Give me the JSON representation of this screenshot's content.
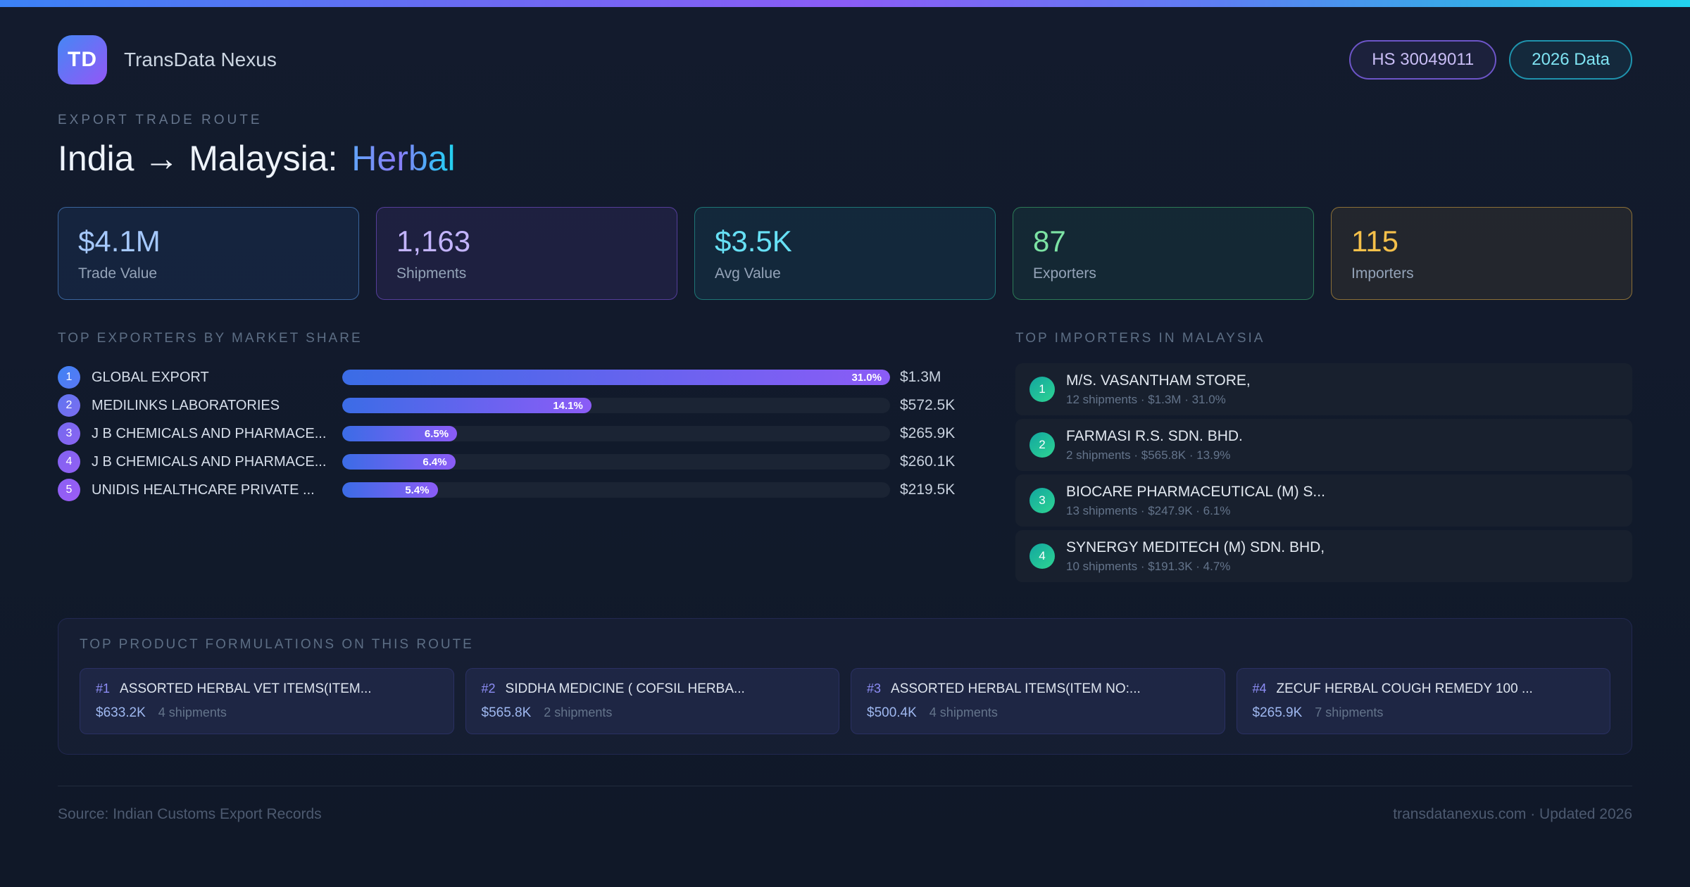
{
  "colors": {
    "accent_blue": "#3b82f6",
    "accent_purple": "#8b5cf6",
    "accent_cyan": "#22d3ee",
    "accent_teal": "#2ed492",
    "accent_amber": "#f5c04a",
    "background": "#111a2b"
  },
  "header": {
    "logo_text": "TD",
    "brand": "TransData Nexus",
    "badges": [
      {
        "label": "HS 30049011"
      },
      {
        "label": "2026 Data"
      }
    ]
  },
  "hero": {
    "eyebrow": "EXPORT TRADE ROUTE",
    "title_main": "India → Malaysia:",
    "title_accent": "Herbal"
  },
  "stats": [
    {
      "value": "$4.1M",
      "label": "Trade Value"
    },
    {
      "value": "1,163",
      "label": "Shipments"
    },
    {
      "value": "$3.5K",
      "label": "Avg Value"
    },
    {
      "value": "87",
      "label": "Exporters"
    },
    {
      "value": "115",
      "label": "Importers"
    }
  ],
  "exporters": {
    "title": "TOP EXPORTERS BY MARKET SHARE",
    "rows": [
      {
        "rank": "1",
        "name": "GLOBAL EXPORT",
        "share_pct": 31.0,
        "share_label": "31.0%",
        "value": "$1.3M"
      },
      {
        "rank": "2",
        "name": "MEDILINKS LABORATORIES",
        "share_pct": 14.1,
        "share_label": "14.1%",
        "value": "$572.5K"
      },
      {
        "rank": "3",
        "name": "J B CHEMICALS AND PHARMACE...",
        "share_pct": 6.5,
        "share_label": "6.5%",
        "value": "$265.9K"
      },
      {
        "rank": "4",
        "name": "J B CHEMICALS AND PHARMACE...",
        "share_pct": 6.4,
        "share_label": "6.4%",
        "value": "$260.1K"
      },
      {
        "rank": "5",
        "name": "UNIDIS HEALTHCARE PRIVATE ...",
        "share_pct": 5.4,
        "share_label": "5.4%",
        "value": "$219.5K"
      }
    ]
  },
  "importers": {
    "title": "TOP IMPORTERS IN MALAYSIA",
    "rows": [
      {
        "rank": "1",
        "name": "M/S. VASANTHAM STORE,",
        "meta": "12 shipments · $1.3M · 31.0%"
      },
      {
        "rank": "2",
        "name": "FARMASI R.S. SDN. BHD.",
        "meta": "2 shipments · $565.8K · 13.9%"
      },
      {
        "rank": "3",
        "name": "BIOCARE PHARMACEUTICAL (M) S...",
        "meta": "13 shipments · $247.9K · 6.1%"
      },
      {
        "rank": "4",
        "name": "SYNERGY MEDITECH (M) SDN. BHD,",
        "meta": "10 shipments · $191.3K · 4.7%"
      }
    ]
  },
  "products": {
    "title": "TOP PRODUCT FORMULATIONS ON THIS ROUTE",
    "cards": [
      {
        "rank": "#1",
        "name": "ASSORTED HERBAL VET ITEMS(ITEM...",
        "value": "$633.2K",
        "shipments": "4 shipments"
      },
      {
        "rank": "#2",
        "name": "SIDDHA MEDICINE ( COFSIL HERBA...",
        "value": "$565.8K",
        "shipments": "2 shipments"
      },
      {
        "rank": "#3",
        "name": "ASSORTED HERBAL ITEMS(ITEM NO:...",
        "value": "$500.4K",
        "shipments": "4 shipments"
      },
      {
        "rank": "#4",
        "name": "ZECUF HERBAL COUGH REMEDY 100 ...",
        "value": "$265.9K",
        "shipments": "7 shipments"
      }
    ]
  },
  "footer": {
    "source": "Source: Indian Customs Export Records",
    "site": "transdatanexus.com · Updated 2026"
  },
  "chart_data": {
    "type": "bar",
    "orientation": "horizontal",
    "title": "TOP EXPORTERS BY MARKET SHARE",
    "categories": [
      "GLOBAL EXPORT",
      "MEDILINKS LABORATORIES",
      "J B CHEMICALS AND PHARMACE...",
      "J B CHEMICALS AND PHARMACE...",
      "UNIDIS HEALTHCARE PRIVATE ..."
    ],
    "values": [
      31.0,
      14.1,
      6.5,
      6.4,
      5.4
    ],
    "value_labels": [
      "$1.3M",
      "$572.5K",
      "$265.9K",
      "$260.1K",
      "$219.5K"
    ],
    "xlabel": "",
    "ylabel": "",
    "xlim": [
      0,
      31.0
    ],
    "bars_scaled_to_max": true
  }
}
